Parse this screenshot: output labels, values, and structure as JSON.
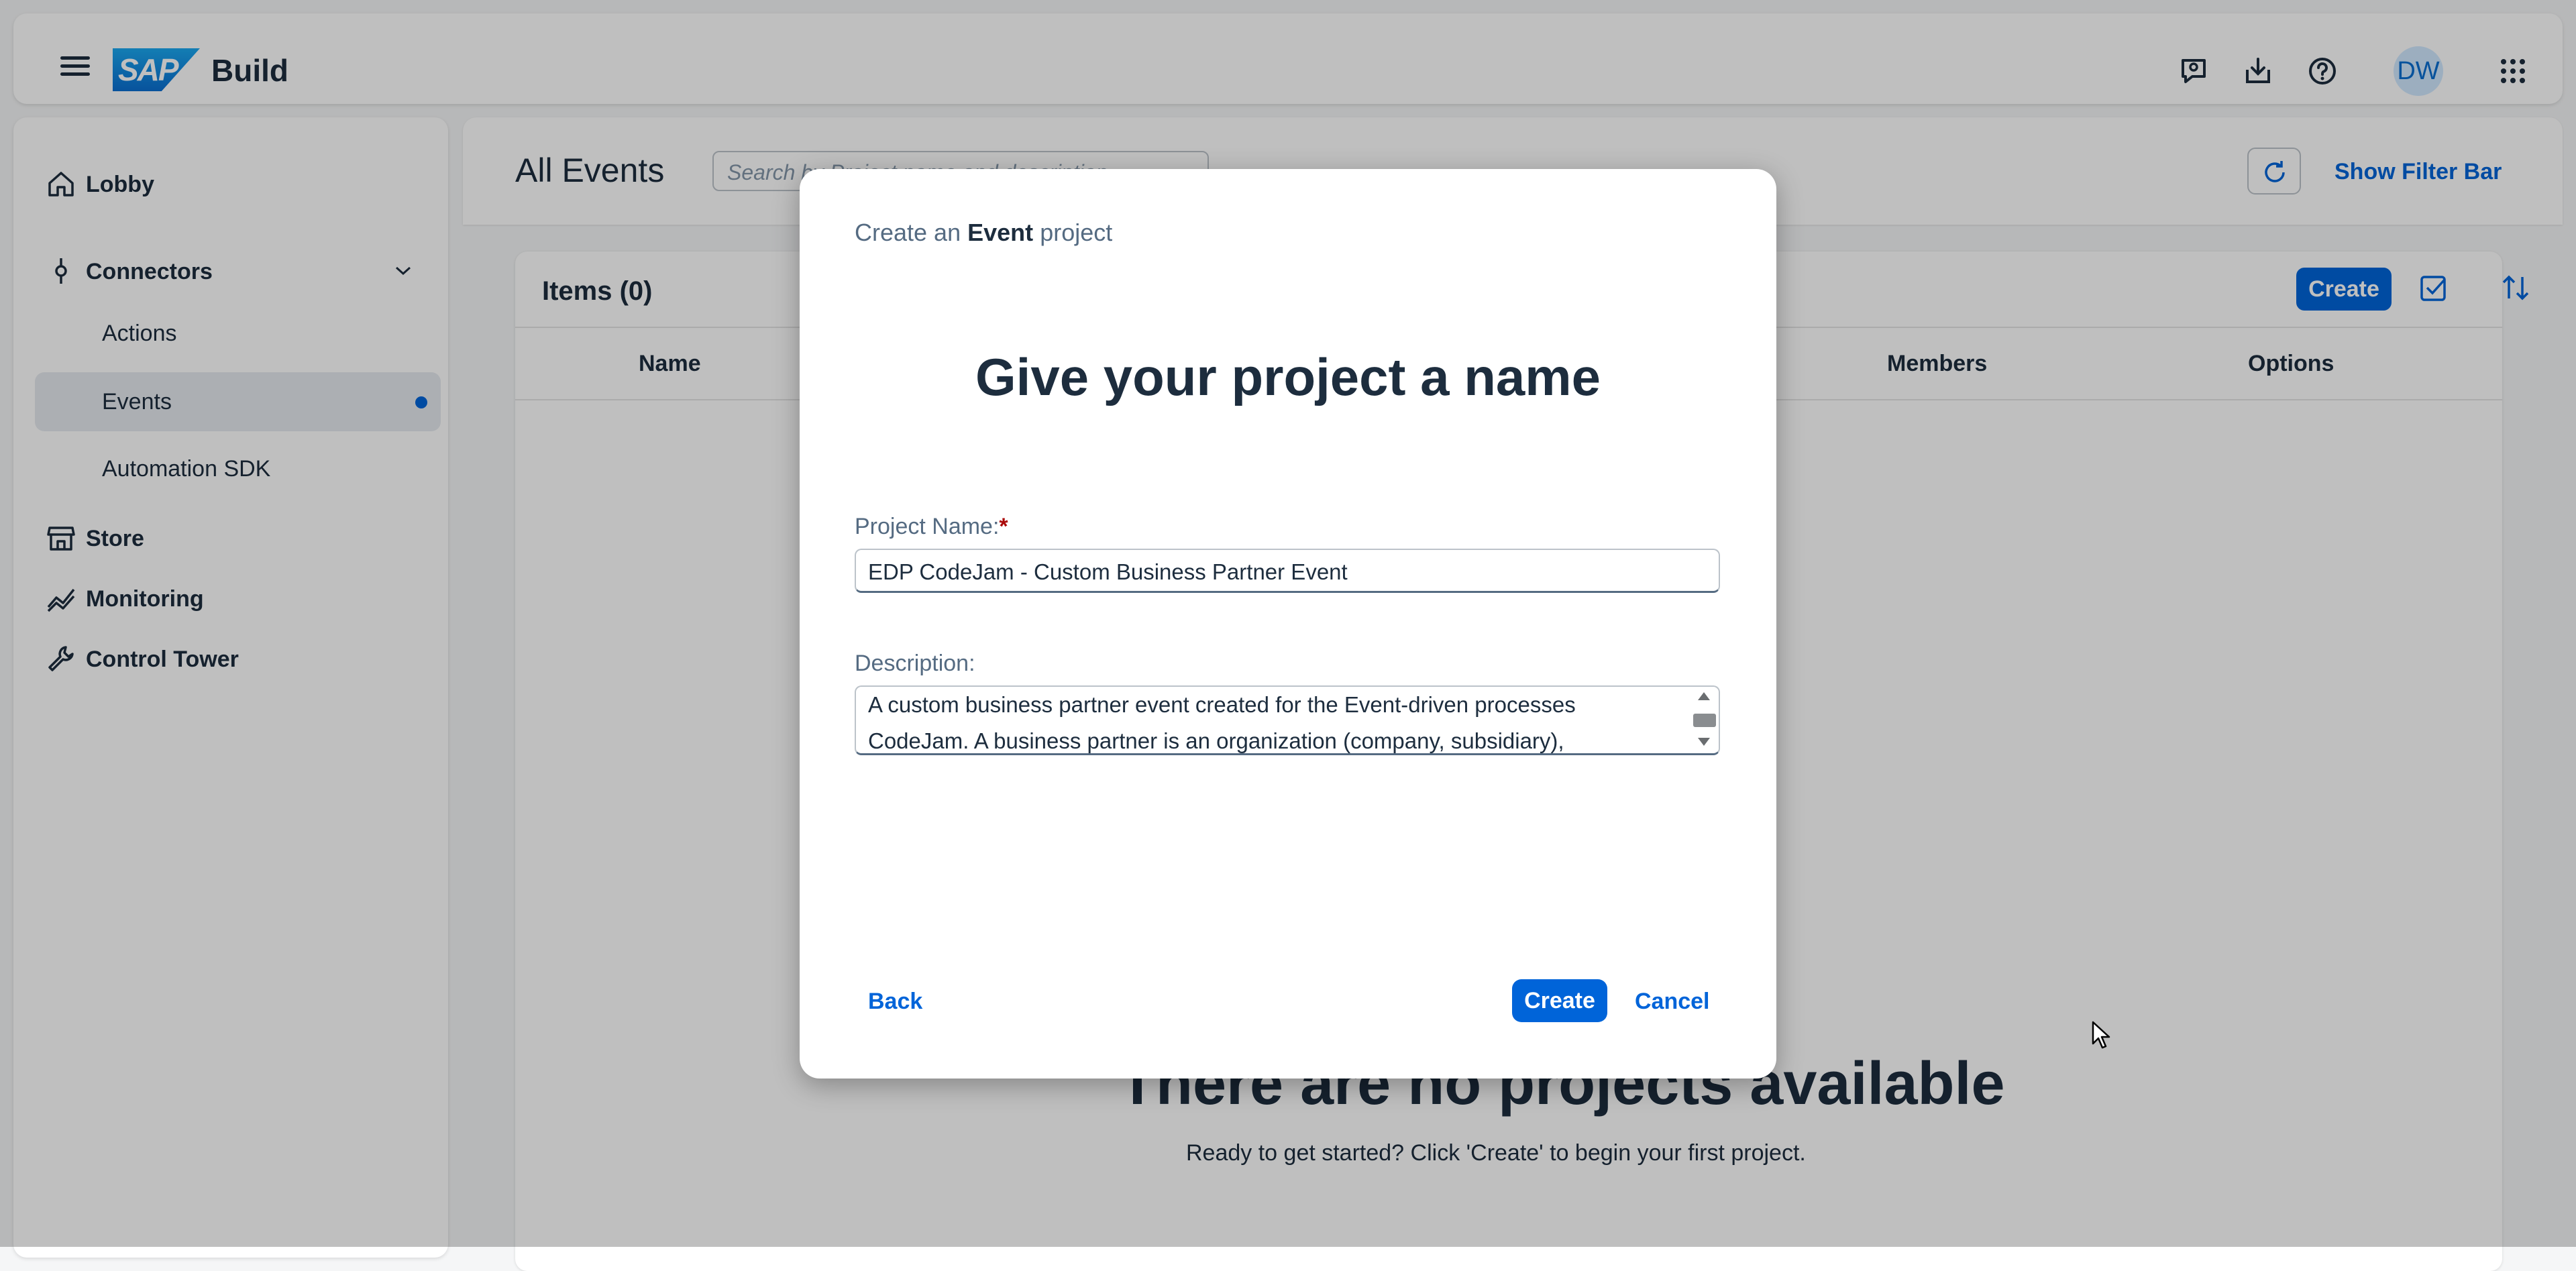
{
  "shell": {
    "logo_text": "SAP",
    "brand": "Build",
    "avatar_initials": "DW",
    "icons": [
      "menu-icon",
      "feedback-icon",
      "downloads-icon",
      "help-icon",
      "product-switch-icon"
    ]
  },
  "sidebar": {
    "items": [
      {
        "label": "Lobby",
        "icon": "home-icon"
      },
      {
        "label": "Connectors",
        "icon": "connector-icon"
      },
      {
        "label": "Actions"
      },
      {
        "label": "Events"
      },
      {
        "label": "Automation SDK"
      },
      {
        "label": "Store",
        "icon": "store-icon"
      },
      {
        "label": "Monitoring",
        "icon": "monitoring-icon"
      },
      {
        "label": "Control Tower",
        "icon": "wrench-icon"
      }
    ],
    "selected": "Events"
  },
  "page": {
    "title": "All Events",
    "search_placeholder": "Search by Project name and description",
    "show_filter_bar": "Show Filter Bar",
    "items_title": "Items (0)",
    "create_label": "Create",
    "columns": [
      "Name",
      "Members",
      "Options"
    ],
    "empty_title": "There are no projects available",
    "empty_subtitle": "Ready to get started? Click 'Create' to begin your first project."
  },
  "dialog": {
    "header_prefix": "Create an",
    "header_bold": "Event",
    "header_suffix": "project",
    "title": "Give your project a name",
    "project_name_label": "Project Name:",
    "required_mark": "*",
    "project_name_value": "EDP CodeJam - Custom Business Partner Event",
    "description_label": "Description:",
    "description_value": "A custom business partner event created for the Event-driven processes CodeJam. A business partner is an organization (company, subsidiary),",
    "back_label": "Back",
    "create_label": "Create",
    "cancel_label": "Cancel"
  },
  "colors": {
    "accent": "#0064d9",
    "text": "#1d2d3e",
    "muted": "#556b82",
    "required": "#aa0808"
  }
}
